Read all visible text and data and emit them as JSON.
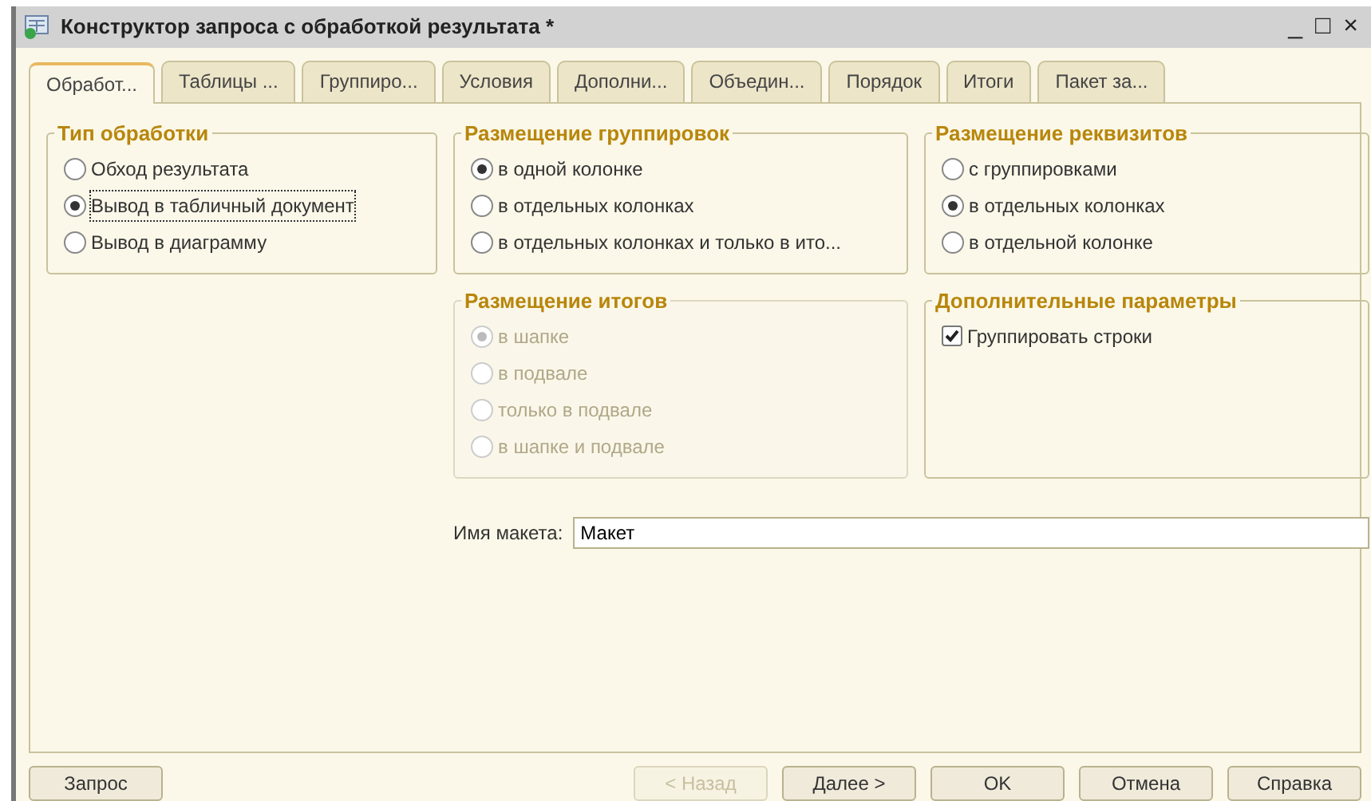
{
  "window": {
    "title": "Конструктор запроса с обработкой результата *",
    "controls": [
      "_",
      "□",
      "×"
    ]
  },
  "tabs": [
    {
      "label": "Обработ...",
      "selected": true
    },
    {
      "label": "Таблицы ...",
      "selected": false
    },
    {
      "label": "Группиро...",
      "selected": false
    },
    {
      "label": "Условия",
      "selected": false
    },
    {
      "label": "Дополни...",
      "selected": false
    },
    {
      "label": "Объедин...",
      "selected": false
    },
    {
      "label": "Порядок",
      "selected": false
    },
    {
      "label": "Итоги",
      "selected": false
    },
    {
      "label": "Пакет за...",
      "selected": false
    }
  ],
  "groups": [
    {
      "title": "Тип обработки",
      "disabled": false,
      "options": [
        {
          "kind": "radio",
          "label": "Обход результата",
          "selected": false,
          "focused": false
        },
        {
          "kind": "radio",
          "label": "Вывод в табличный документ",
          "selected": true,
          "focused": true
        },
        {
          "kind": "radio",
          "label": "Вывод в диаграмму",
          "selected": false,
          "focused": false
        }
      ]
    },
    {
      "title": "Размещение группировок",
      "disabled": false,
      "options": [
        {
          "kind": "radio",
          "label": "в одной колонке",
          "selected": true,
          "focused": false
        },
        {
          "kind": "radio",
          "label": "в отдельных колонках",
          "selected": false,
          "focused": false
        },
        {
          "kind": "radio",
          "label": "в отдельных колонках и только в ито...",
          "selected": false,
          "focused": false
        }
      ]
    },
    {
      "title": "Размещение реквизитов",
      "disabled": false,
      "options": [
        {
          "kind": "radio",
          "label": "с группировками",
          "selected": false,
          "focused": false
        },
        {
          "kind": "radio",
          "label": "в отдельных колонках",
          "selected": true,
          "focused": false
        },
        {
          "kind": "radio",
          "label": "в отдельной колонке",
          "selected": false,
          "focused": false
        }
      ]
    },
    {
      "title": "Размещение итогов",
      "disabled": true,
      "options": [
        {
          "kind": "radio",
          "label": "в шапке",
          "selected": true,
          "focused": false
        },
        {
          "kind": "radio",
          "label": "в подвале",
          "selected": false,
          "focused": false
        },
        {
          "kind": "radio",
          "label": "только в подвале",
          "selected": false,
          "focused": false
        },
        {
          "kind": "radio",
          "label": "в шапке и подвале",
          "selected": false,
          "focused": false
        }
      ]
    },
    {
      "title": "Дополнительные параметры",
      "disabled": false,
      "options": [
        {
          "kind": "checkbox",
          "label": "Группировать строки",
          "checked": true,
          "focused": false
        }
      ]
    }
  ],
  "template_name": {
    "label": "Имя макета:",
    "value": "Макет"
  },
  "buttons": [
    {
      "label": "Запрос",
      "disabled": false
    },
    {
      "label": "< Назад",
      "disabled": true
    },
    {
      "label": "Далее >",
      "disabled": false
    },
    {
      "label": "OK",
      "disabled": false
    },
    {
      "label": "Отмена",
      "disabled": false
    },
    {
      "label": "Справка",
      "disabled": false
    }
  ]
}
